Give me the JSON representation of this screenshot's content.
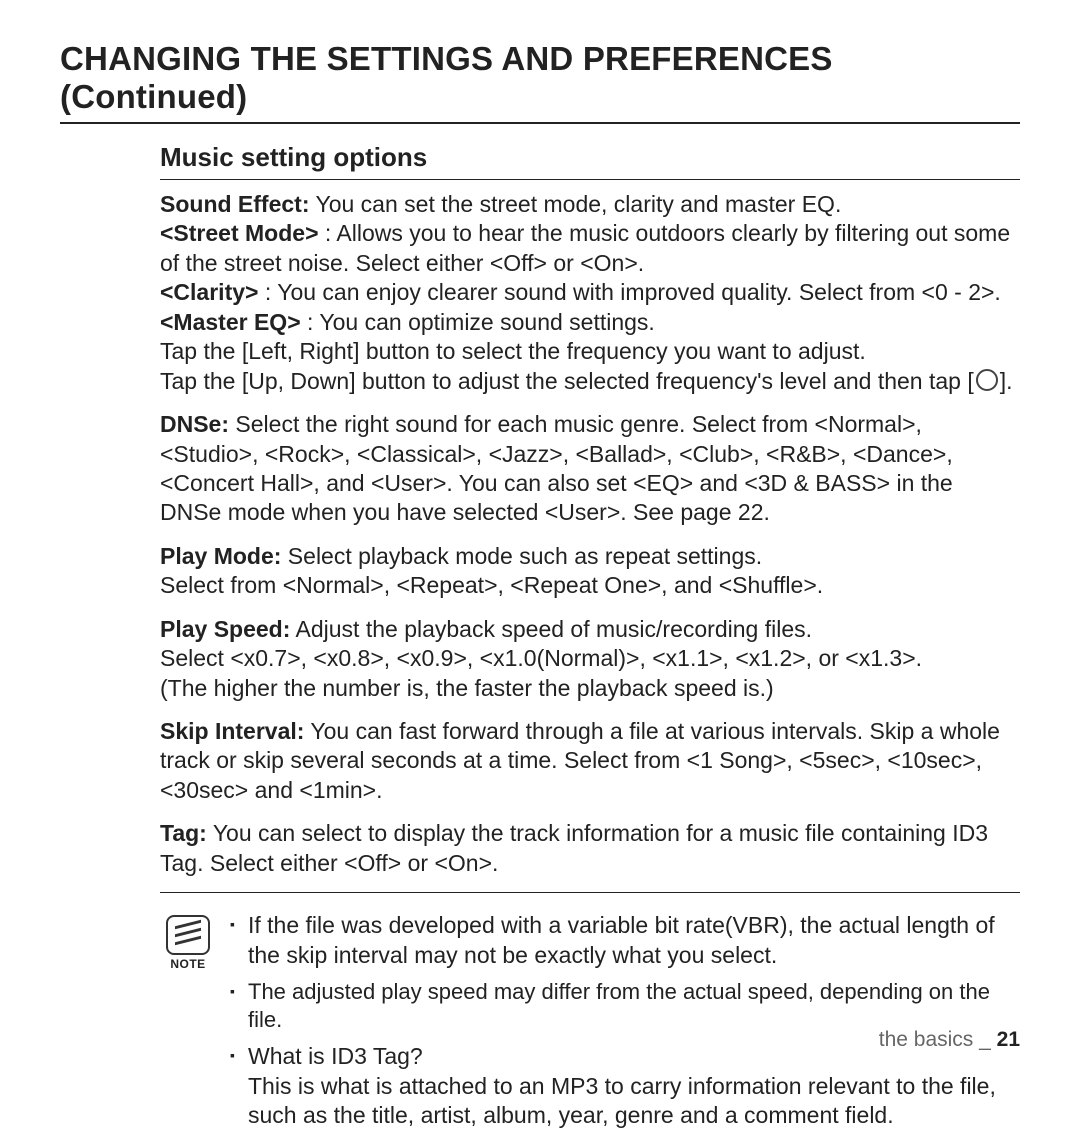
{
  "title": "CHANGING THE SETTINGS AND PREFERENCES (Continued)",
  "subtitle": "Music setting options",
  "soundEffect": {
    "label": "Sound Effect:",
    "text": " You can set the street mode, clarity and master EQ."
  },
  "streetMode": {
    "label": "<Street Mode>",
    "text": " : Allows you to hear the music outdoors clearly by filtering out some of the street noise. Select either <Off> or <On>."
  },
  "clarity": {
    "label": "<Clarity>",
    "text": " : You can enjoy clearer sound with improved quality. Select from <0 - 2>."
  },
  "masterEQ": {
    "label": "<Master EQ>",
    "text": " : You can optimize sound settings."
  },
  "eqLine1": "Tap the [Left, Right] button to select the frequency you want to adjust.",
  "eqLine2a": "Tap the [Up, Down] button to adjust the selected frequency's level and then tap [",
  "eqLine2b": "].",
  "dnse": {
    "label": "DNSe:",
    "text": " Select the right sound for each music genre. Select from <Normal>, <Studio>, <Rock>, <Classical>, <Jazz>, <Ballad>, <Club>, <R&B>, <Dance>, <Concert Hall>, and <User>. You can also set <EQ> and <3D & BASS> in the DNSe mode when you have selected <User>. See page 22."
  },
  "playMode": {
    "label": "Play Mode:",
    "text": " Select playback mode such as repeat settings.",
    "text2": "Select from <Normal>, <Repeat>, <Repeat One>, and <Shuffle>."
  },
  "playSpeed": {
    "label": "Play Speed:",
    "text": " Adjust the playback speed of music/recording files.",
    "text2": "Select <x0.7>, <x0.8>, <x0.9>, <x1.0(Normal)>, <x1.1>, <x1.2>, or <x1.3>.",
    "text3": "(The higher the number is, the faster the playback speed is.)"
  },
  "skipInterval": {
    "label": "Skip Interval:",
    "text": " You can fast forward through a file at various intervals. Skip a whole track or skip several seconds at a time. Select from <1 Song>, <5sec>, <10sec>, <30sec> and <1min>."
  },
  "tag": {
    "label": "Tag:",
    "text": " You can select to display the track information for a music file containing ID3 Tag. Select either <Off> or <On>."
  },
  "noteLabel": "NOTE",
  "notes": {
    "n1": "If the file was developed with a variable bit rate(VBR), the actual length of the skip interval may not be exactly what you select.",
    "n2": "The adjusted play speed may differ from the actual speed, depending on the file.",
    "n3label": "What is ID3 Tag?",
    "n3text": "This is what is attached to an MP3 to carry information relevant to the file, such as the title, artist, album, year, genre and a comment field."
  },
  "footer": {
    "section": "the basics _ ",
    "page": "21"
  }
}
